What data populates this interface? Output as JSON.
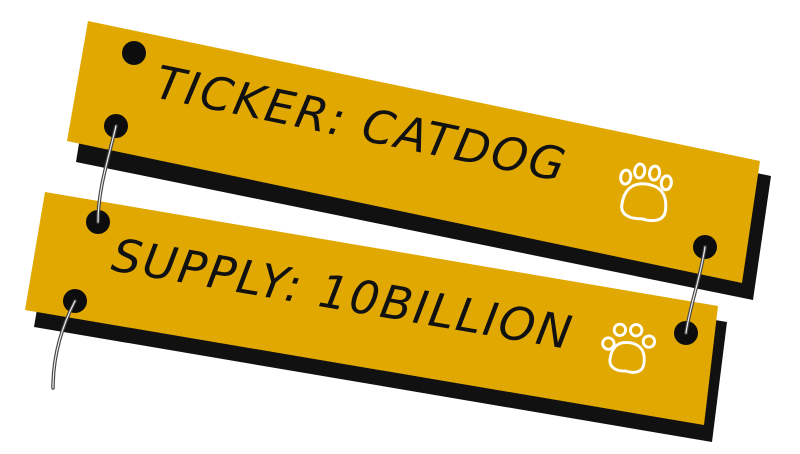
{
  "signs": [
    {
      "label": "TICKER: CATDOG"
    },
    {
      "label": "SUPPLY: 10BILLION"
    }
  ],
  "colors": {
    "board": "#E0A800",
    "shadow": "#111111",
    "text": "#111111",
    "paw": "#FFFFFF",
    "hole": "#0d0d0d",
    "wire": "#555555"
  },
  "icons": [
    "paw-print-icon",
    "paw-print-icon"
  ]
}
